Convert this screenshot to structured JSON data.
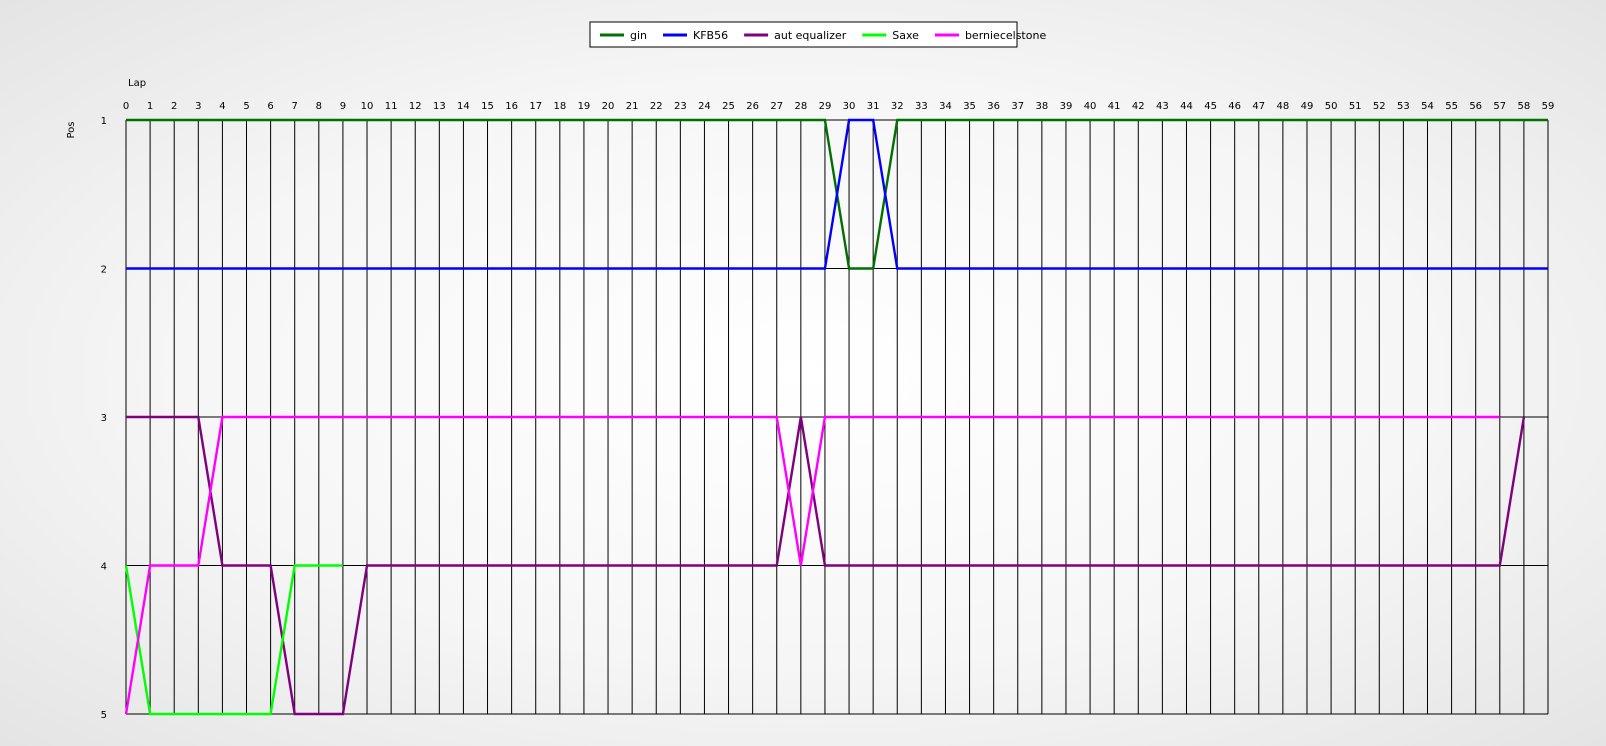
{
  "chart_data": {
    "type": "line",
    "xlabel": "Lap",
    "ylabel": "Pos",
    "x": [
      0,
      1,
      2,
      3,
      4,
      5,
      6,
      7,
      8,
      9,
      10,
      11,
      12,
      13,
      14,
      15,
      16,
      17,
      18,
      19,
      20,
      21,
      22,
      23,
      24,
      25,
      26,
      27,
      28,
      29,
      30,
      31,
      32,
      33,
      34,
      35,
      36,
      37,
      38,
      39,
      40,
      41,
      42,
      43,
      44,
      45,
      46,
      47,
      48,
      49,
      50,
      51,
      52,
      53,
      54,
      55,
      56,
      57,
      58,
      59
    ],
    "xlim": [
      0,
      59
    ],
    "ylim": [
      1,
      5
    ],
    "y_ticks": [
      1,
      2,
      3,
      4,
      5
    ],
    "y_inverted": true,
    "grid": true,
    "legend_position": "top-center",
    "series": [
      {
        "name": "gin",
        "color": "#007000",
        "points": [
          [
            0,
            1
          ],
          [
            29,
            1
          ],
          [
            30,
            2
          ],
          [
            31,
            2
          ],
          [
            32,
            1
          ],
          [
            59,
            1
          ]
        ]
      },
      {
        "name": "KFB56",
        "color": "#0000ff",
        "points": [
          [
            0,
            2
          ],
          [
            29,
            2
          ],
          [
            30,
            1
          ],
          [
            31,
            1
          ],
          [
            32,
            2
          ],
          [
            59,
            2
          ]
        ]
      },
      {
        "name": "aut equalizer",
        "color": "#800080",
        "points": [
          [
            0,
            3
          ],
          [
            3,
            3
          ],
          [
            4,
            4
          ],
          [
            6,
            4
          ],
          [
            7,
            5
          ],
          [
            9,
            5
          ],
          [
            10,
            4
          ],
          [
            27,
            4
          ],
          [
            28,
            3
          ],
          [
            29,
            4
          ],
          [
            57,
            4
          ],
          [
            58,
            3
          ]
        ]
      },
      {
        "name": "Saxe",
        "color": "#00ff00",
        "points": [
          [
            0,
            4
          ],
          [
            1,
            5
          ],
          [
            6,
            5
          ],
          [
            7,
            4
          ],
          [
            9,
            4
          ]
        ]
      },
      {
        "name": "berniecelstone",
        "color": "#ff00ff",
        "points": [
          [
            0,
            5
          ],
          [
            1,
            4
          ],
          [
            3,
            4
          ],
          [
            4,
            3
          ],
          [
            27,
            3
          ],
          [
            28,
            4
          ],
          [
            29,
            3
          ],
          [
            57,
            3
          ]
        ]
      }
    ]
  }
}
